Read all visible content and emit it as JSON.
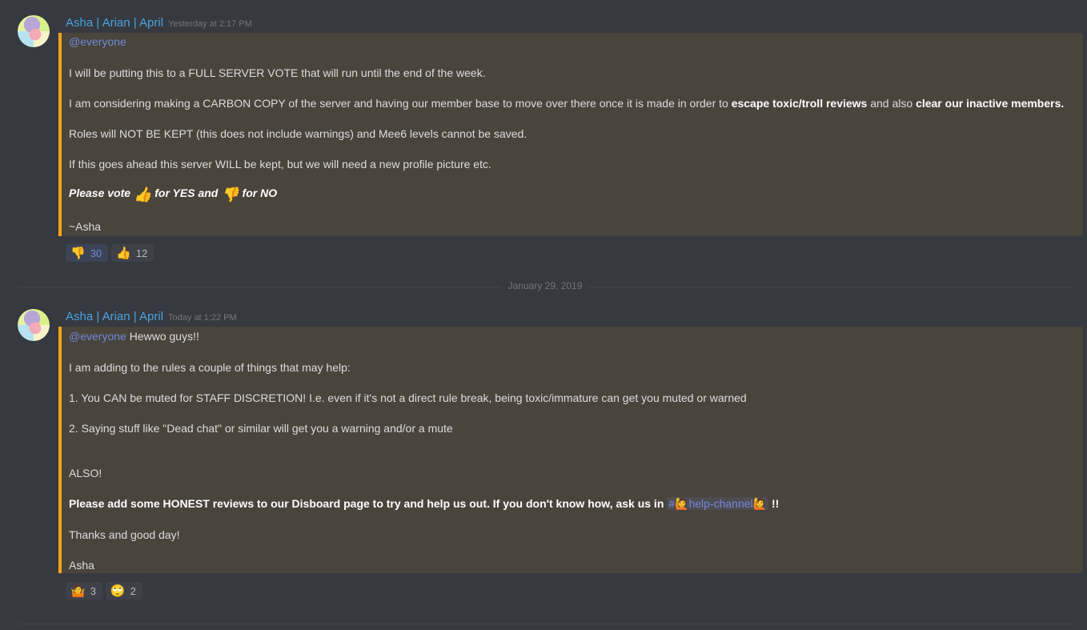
{
  "colors": {
    "background": "#36393f",
    "highlight": "#49443c",
    "highlight_bar": "#faa61a",
    "username": "#4aa3df",
    "mention": "#7289da",
    "timestamp": "#72767d"
  },
  "messages": [
    {
      "author": "Asha | Arian | April",
      "timestamp": "Yesterday at 2:17 PM",
      "mention": "@everyone",
      "lines": {
        "l1": "I will be putting this to a FULL SERVER VOTE that will run until the end of the week.",
        "l2a": "I am considering making a CARBON COPY of the server and having our member base to move over there once it is made in order to ",
        "l2b": "escape toxic/troll reviews",
        "l2c": " and also ",
        "l2d": "clear our inactive members.",
        "l3": "Roles will NOT BE KEPT (this does not include warnings) and Mee6 levels cannot be saved.",
        "l4": "If this goes ahead this server WILL be kept, but we will need a new profile picture etc.",
        "l5a": "Please vote ",
        "l5b": " for YES and ",
        "l5c": " for NO",
        "l6": "~Asha"
      },
      "emoji": {
        "thumbs_up": "👍",
        "thumbs_down": "👎"
      },
      "reactions": [
        {
          "emoji": "👎",
          "name": "thumbs-down",
          "count": "30",
          "me": true
        },
        {
          "emoji": "👍",
          "name": "thumbs-up",
          "count": "12",
          "me": false
        }
      ]
    },
    {
      "author": "Asha | Arian | April",
      "timestamp": "Today at 1:22 PM",
      "mention": "@everyone",
      "lines": {
        "l1": " Hewwo guys!!",
        "l2": "I am adding to the rules a couple of things that may help:",
        "l3": "1. You CAN be muted for STAFF DISCRETION! I.e. even if it's not a direct rule break, being toxic/immature can get you muted or warned",
        "l4": "2. Saying stuff like \"Dead chat\" or similar will get you a warning and/or a mute",
        "l5": "ALSO!",
        "l6a": "Please add some HONEST reviews to our Disboard page to try and help us out. If you don't know how, ask us in ",
        "l6b": "#🙋help-channel🙋",
        "l6c": " !!",
        "l7": "Thanks and good day!",
        "l8": "Asha"
      },
      "reactions": [
        {
          "emoji": "🤷",
          "name": "shrug",
          "count": "3",
          "me": false
        },
        {
          "emoji": "🙄",
          "name": "eye-roll",
          "count": "2",
          "me": false
        }
      ]
    }
  ],
  "date_divider": "January 29, 2019"
}
